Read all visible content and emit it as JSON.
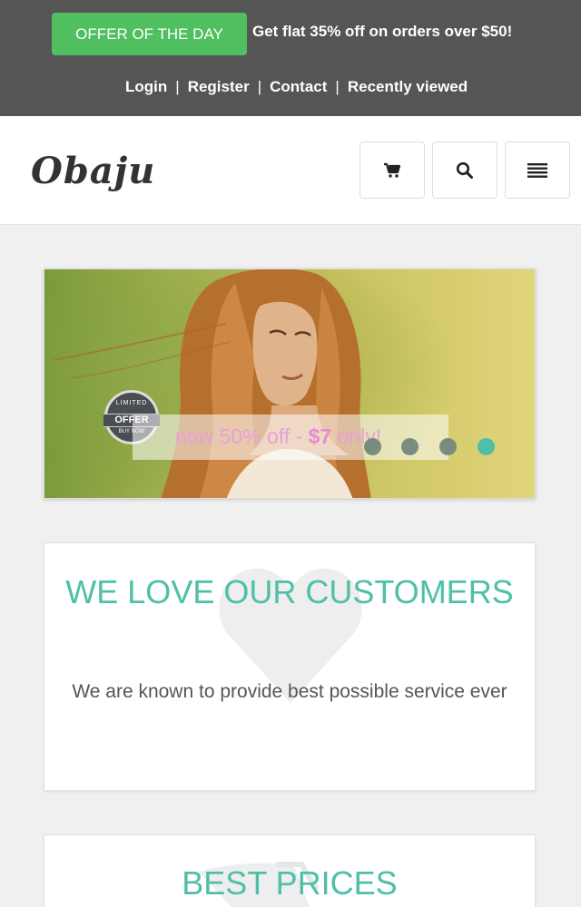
{
  "topbar": {
    "offer_label": "OFFER OF THE DAY",
    "offer_text": "Get flat 35% off on orders over $50!",
    "links": [
      "Login",
      "Register",
      "Contact",
      "Recently viewed"
    ]
  },
  "navbar": {
    "logo": "Obaju",
    "buttons": [
      "cart-icon",
      "search-icon",
      "menu-icon"
    ]
  },
  "slider": {
    "badge": {
      "top": "LIMITED",
      "main": "OFFER",
      "bottom": "BUY NOW"
    },
    "caption_prefix": "now 50% off - ",
    "caption_price": "$7",
    "caption_suffix": " only!",
    "dots_count": 4,
    "active_dot": 4
  },
  "features": [
    {
      "title": "WE LOVE OUR CUSTOMERS",
      "text": "We are known to provide best possible service ever",
      "icon": "heart-icon"
    },
    {
      "title": "BEST PRICES",
      "icon": "plane-icon"
    }
  ],
  "colors": {
    "topbar_bg": "#555555",
    "offer_green": "#4fbf60",
    "accent_teal": "#4fbfa8",
    "caption_pink": "#e78cd3"
  }
}
